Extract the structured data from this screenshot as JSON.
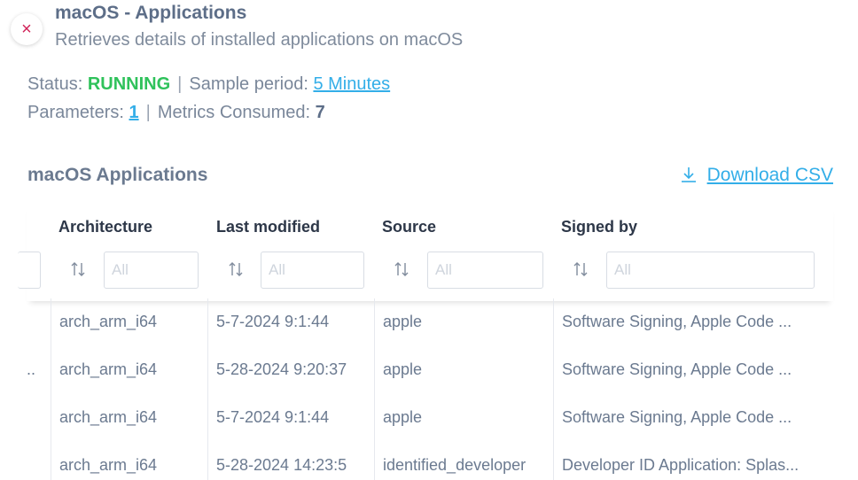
{
  "header": {
    "close_icon": "close-icon",
    "close_symbol": "×",
    "title": "macOS - Applications",
    "subtitle": "Retrieves details of installed applications on macOS"
  },
  "status": {
    "status_label": "Status: ",
    "status_value": "RUNNING",
    "separator": "|",
    "sample_label": "Sample period: ",
    "sample_value": "5 Minutes",
    "parameters_label": "Parameters: ",
    "parameters_value": "1",
    "metrics_label": "Metrics Consumed: ",
    "metrics_value": "7"
  },
  "section": {
    "title": "macOS Applications",
    "download_label": "Download CSV",
    "download_icon": "download-icon"
  },
  "table": {
    "columns": [
      {
        "label": "Architecture",
        "filter_placeholder": "All"
      },
      {
        "label": "Last modified",
        "filter_placeholder": "All"
      },
      {
        "label": "Source",
        "filter_placeholder": "All"
      },
      {
        "label": "Signed by",
        "filter_placeholder": "All"
      }
    ],
    "sort_icon": "sort-icon",
    "rows": [
      {
        "prev": "",
        "architecture": "arch_arm_i64",
        "last_modified": "5-7-2024 9:1:44",
        "source": "apple",
        "signed_by": "Software Signing, Apple Code ..."
      },
      {
        "prev": "..",
        "architecture": "arch_arm_i64",
        "last_modified": "5-28-2024 9:20:37",
        "source": "apple",
        "signed_by": "Software Signing, Apple Code ..."
      },
      {
        "prev": "",
        "architecture": "arch_arm_i64",
        "last_modified": "5-7-2024 9:1:44",
        "source": "apple",
        "signed_by": "Software Signing, Apple Code ..."
      },
      {
        "prev": "",
        "architecture": "arch_arm_i64",
        "last_modified": "5-28-2024 14:23:5",
        "source": "identified_developer",
        "signed_by": "Developer ID Application: Splas..."
      }
    ]
  },
  "colors": {
    "running": "#2fc25b",
    "link": "#33aee8",
    "close": "#d1245a"
  }
}
